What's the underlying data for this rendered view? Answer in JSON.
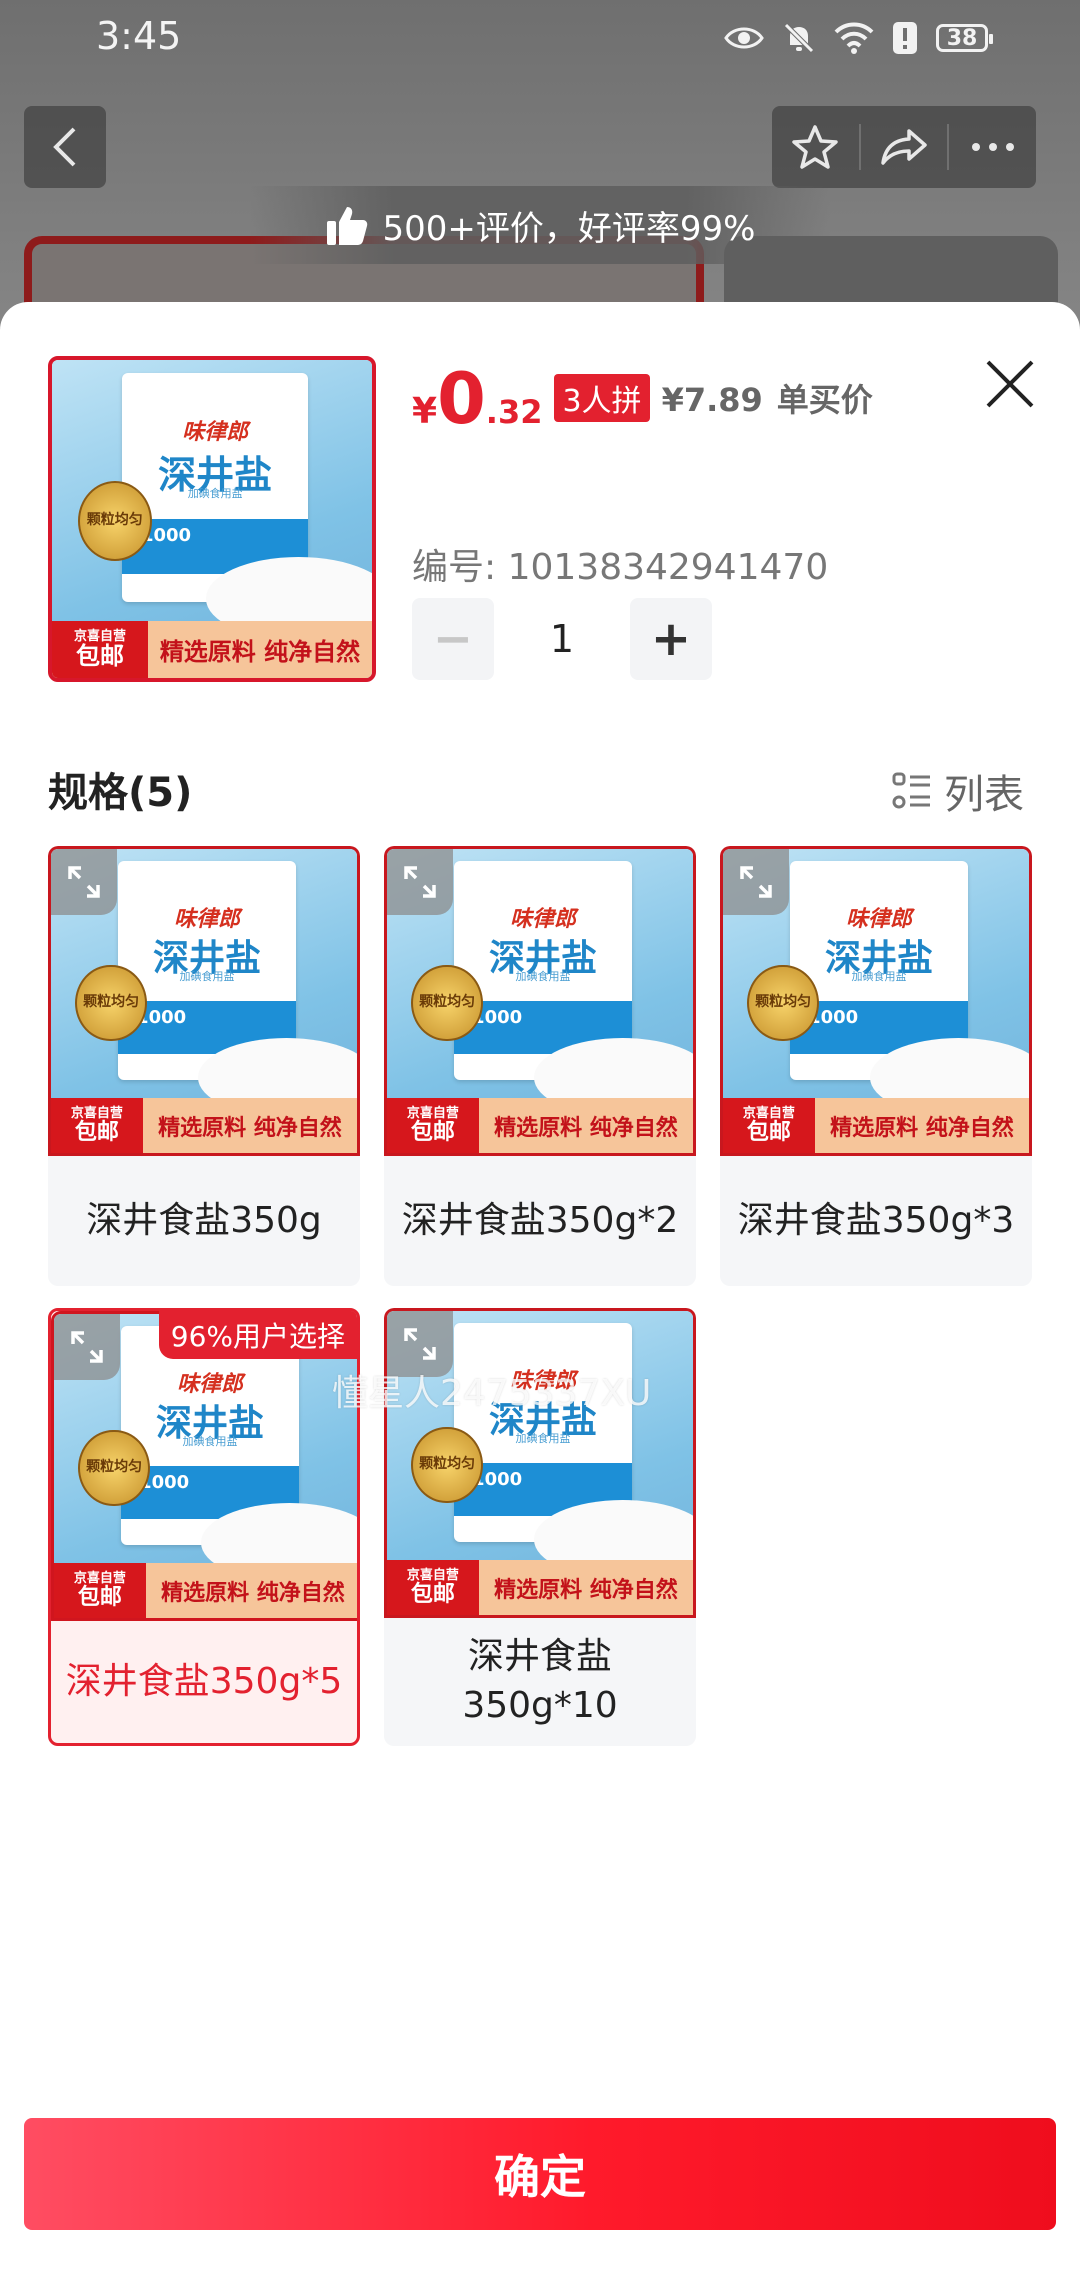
{
  "status_bar": {
    "time": "3:45",
    "battery": "38"
  },
  "background": {
    "review_text": "500+评价，好评率99%"
  },
  "product": {
    "price_yen": "¥",
    "price_int": "0",
    "price_dec": ".32",
    "group_badge": "3人拼",
    "single_price": "¥7.89",
    "single_label": "单买价",
    "sku": "编号: 10138342941470",
    "quantity": "1",
    "minus": "−",
    "plus": "+"
  },
  "artwork": {
    "brand": "味律郎",
    "name": "深井盐",
    "sub": "加碘食用盐",
    "band_text": "1000",
    "medal": "颗粒均匀",
    "ship_top": "京喜自营",
    "ship_bottom": "包邮",
    "slogan": "精选原料 纯净自然"
  },
  "spec": {
    "title": "规格(5)",
    "list_label": "列表",
    "options": [
      {
        "label": "深井食盐350g"
      },
      {
        "label": "深井食盐350g*2"
      },
      {
        "label": "深井食盐350g*3"
      },
      {
        "label": "深井食盐350g*5",
        "badge": "96%用户选择",
        "selected": true
      },
      {
        "label": "深井食盐\n350g*10"
      }
    ]
  },
  "watermark": "懂星人2475337XU",
  "confirm_label": "确定",
  "colors": {
    "accent": "#e3212f",
    "button_start": "#ff4d62",
    "button_end": "#ef0d1d"
  }
}
